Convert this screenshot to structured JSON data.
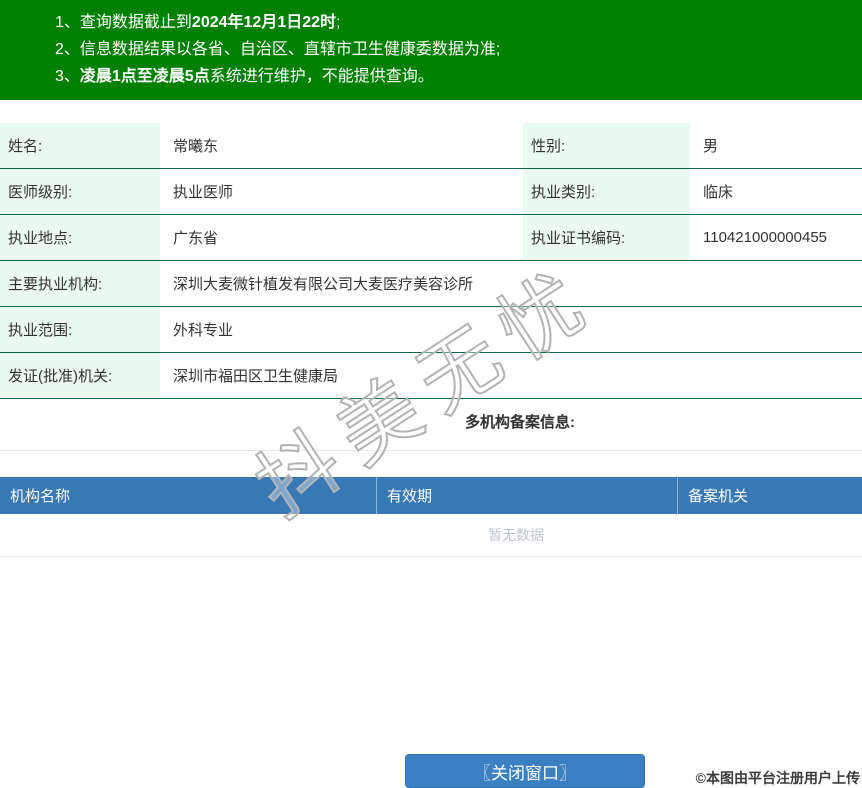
{
  "banner": {
    "notices": [
      {
        "num": "1、",
        "pre": "查询数据截止到",
        "bold": "2024年12月1日22时",
        "post": ";"
      },
      {
        "num": "2、",
        "pre": "信息数据结果以各省、自治区、直辖市卫生健康委数据为准;",
        "bold": "",
        "post": ""
      },
      {
        "num": "3、",
        "pre": "",
        "bold": "凌晨1点至凌晨5点",
        "post": "系统进行维护，不能提供查询。"
      }
    ]
  },
  "fields": {
    "name": {
      "label": "姓名:",
      "value": "常曦东"
    },
    "gender": {
      "label": "性别:",
      "value": "男"
    },
    "level": {
      "label": "医师级别:",
      "value": "执业医师"
    },
    "category": {
      "label": "执业类别:",
      "value": "临床"
    },
    "location": {
      "label": "执业地点:",
      "value": "广东省"
    },
    "cert_no": {
      "label": "执业证书编码:",
      "value": "110421000000455"
    },
    "main_org": {
      "label": "主要执业机构:",
      "value": "深圳大麦微针植发有限公司大麦医疗美容诊所"
    },
    "scope": {
      "label": "执业范围:",
      "value": "外科专业"
    },
    "issuing_authority": {
      "label": "发证(批准)机关:",
      "value": "深圳市福田区卫生健康局"
    }
  },
  "multi_org": {
    "title": "多机构备案信息:",
    "columns": [
      "机构名称",
      "有效期",
      "备案机关"
    ],
    "empty_text": "暂无数据"
  },
  "watermark_text": "抖美无忧",
  "footer": {
    "close_button": "〖关闭窗口〗",
    "copyright": "©本图由平台注册用户上传"
  },
  "colors": {
    "banner_green": "#008000",
    "row_border_green": "#0a6a4e",
    "label_bg_mint": "#eafaf1",
    "header_blue": "#3878b5",
    "button_blue": "#3a80c2",
    "empty_text_gray": "#c0c4cc"
  }
}
